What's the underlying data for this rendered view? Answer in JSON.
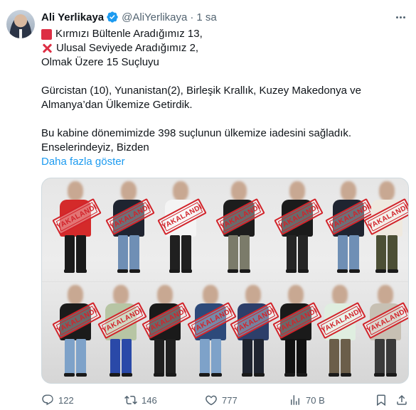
{
  "tweet": {
    "author": {
      "name": "Ali Yerlikaya",
      "handle": "@AliYerlikaya",
      "time": "1 sa"
    },
    "text": {
      "line1": "Kırmızı Bültenle Aradığımız 13,",
      "line2": "Ulusal Seviyede Aradığımız 2,",
      "line3": "Olmak Üzere 15 Suçluyu",
      "line4": "Gürcistan (10), Yunanistan(2), Birleşik Krallık, Kuzey Makedonya ve",
      "line5": "Almanya’dan Ülkemize Getirdik.",
      "line6": "Bu kabine dönemimizde 398 suçlunun ülkemize iadesini sağladık.",
      "line7": "Enselerindeyiz, Bizden"
    },
    "show_more": "Daha fazla göster",
    "media": {
      "stamp_text": "YAKALANDI",
      "people_count": 15
    },
    "actions": {
      "replies": "122",
      "reposts": "146",
      "likes": "777",
      "views": "70 B"
    },
    "colors": {
      "link": "#1d9bf0",
      "verified": "#1d9bf0",
      "stamp": "#d2232a",
      "muted": "#536471"
    }
  }
}
